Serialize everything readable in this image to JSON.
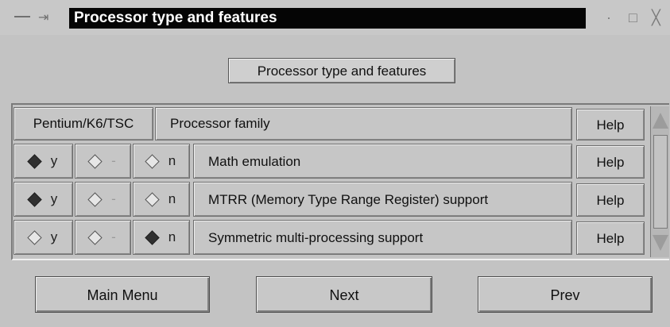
{
  "window": {
    "title": "Processor type and features",
    "pin_glyph": "⇥",
    "minimize_glyph": "·",
    "maximize_glyph": "□",
    "close_glyph": "╳"
  },
  "section": {
    "heading": "Processor type and features"
  },
  "family_row": {
    "value": "Pentium/K6/TSC",
    "label": "Processor family",
    "help": "Help"
  },
  "options": [
    {
      "label": "Math emulation",
      "y": "y",
      "m": "-",
      "n": "n",
      "selected": "y",
      "help": "Help"
    },
    {
      "label": "MTRR (Memory Type Range Register) support",
      "y": "y",
      "m": "-",
      "n": "n",
      "selected": "y",
      "help": "Help"
    },
    {
      "label": "Symmetric multi-processing support",
      "y": "y",
      "m": "-",
      "n": "n",
      "selected": "n",
      "help": "Help"
    }
  ],
  "footer": {
    "main_menu": "Main Menu",
    "next": "Next",
    "prev": "Prev"
  }
}
